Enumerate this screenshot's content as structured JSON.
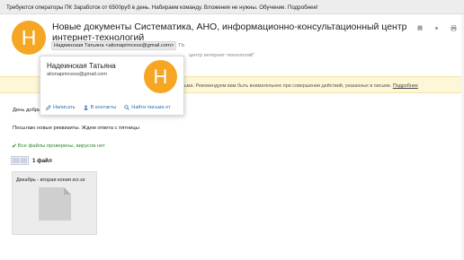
{
  "ad_bar": {
    "text": "Требуются операторы ПК Заработок от 6500руб в день. Набираем команду. Вложения не нужны. Обучение. Подробнее!"
  },
  "message": {
    "avatar_letter": "Н",
    "subject": "Новые документы Систематика, АНО, информационно-консультационный центр интернет-технологий",
    "sender": "Надеинская Татьяна <alionaprincess@gmail.com>",
    "sender_rest": "ТЬ",
    "to_line": "центр интернет-технологий\""
  },
  "header_icons": [
    "bookmark-icon",
    "dot-icon",
    "print-icon"
  ],
  "warning": {
    "text": "ьма. Рекомендуем вам быть внимательнее при совершении действий, указанных в письме.",
    "link": "Подробнее"
  },
  "body": {
    "greeting": "День добры",
    "text": "Посылаю новые реквизиты. Ждем ответа с пятницы"
  },
  "virus_check": {
    "text": "Все файлы проверены, вирусов нет"
  },
  "attachments": {
    "count_label": "1 файл",
    "files": [
      {
        "name": "Декабрь - вторая копия scr.xz"
      }
    ]
  },
  "contact_popup": {
    "name": "Надеинская Татьяна",
    "email": "alionaprincess@gmail.com",
    "avatar_letter": "Н",
    "actions": {
      "write": "Написать",
      "contacts": "В контакты",
      "find_letters": "Найти письма от"
    }
  },
  "colors": {
    "avatar": "#f5a623",
    "link": "#2f6fb5",
    "virus_ok": "#2c8a2c",
    "warning_bg": "#fdf7d7",
    "ad_bar_bg": "#ededed"
  }
}
